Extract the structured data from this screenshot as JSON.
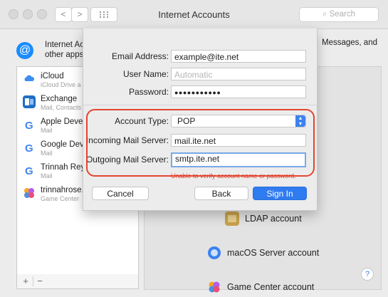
{
  "window": {
    "title": "Internet Accounts",
    "search_placeholder": "Search",
    "back_glyph": "<",
    "forward_glyph": ">"
  },
  "header": {
    "icon_glyph": "@",
    "text_line1": "Internet Ac",
    "text_line2": "other apps",
    "right_text": "Messages, and"
  },
  "accounts": [
    {
      "name": "iCloud",
      "sub": "iCloud Drive a",
      "icon": "icloud-icon",
      "color": "#6aa9f2"
    },
    {
      "name": "Exchange",
      "sub": "Mail, Contacts",
      "icon": "exchange-icon",
      "color": "#1f6fc5"
    },
    {
      "name": "Apple Devel",
      "sub": "Mail",
      "icon": "google-icon",
      "color": "#ea4335"
    },
    {
      "name": "Google Deve",
      "sub": "Mail",
      "icon": "google-icon",
      "color": "#ea4335"
    },
    {
      "name": "Trinnah Rey",
      "sub": "Mail",
      "icon": "google-icon",
      "color": "#ea4335"
    },
    {
      "name": "trinnahrose.",
      "sub": "Game Center",
      "icon": "game-center-icon",
      "color": "#b45cf0"
    }
  ],
  "sidebar_buttons": {
    "add": "+",
    "remove": "−"
  },
  "right_panel": {
    "items": [
      {
        "label": "LDAP account",
        "icon": "ldap-icon"
      },
      {
        "label": "macOS Server account",
        "icon": "macos-server-icon"
      },
      {
        "label": "Game Center account",
        "icon": "game-center-icon"
      }
    ],
    "help": "?"
  },
  "sheet": {
    "email_label": "Email Address:",
    "email_value": "example@ite.net",
    "username_label": "User Name:",
    "username_placeholder": "Automatic",
    "password_label": "Password:",
    "password_value": "●●●●●●●●●●●",
    "account_type_label": "Account Type:",
    "account_type_value": "POP",
    "incoming_label": "Incoming Mail Server:",
    "incoming_value": "mail.ite.net",
    "outgoing_label": "Outgoing Mail Server:",
    "outgoing_value": "smtp.ite.net",
    "error_text": "Unable to verify account name or password.",
    "cancel_label": "Cancel",
    "back_label": "Back",
    "signin_label": "Sign In"
  },
  "colors": {
    "accent": "#2f7bf0",
    "highlight_border": "#e2452f"
  }
}
